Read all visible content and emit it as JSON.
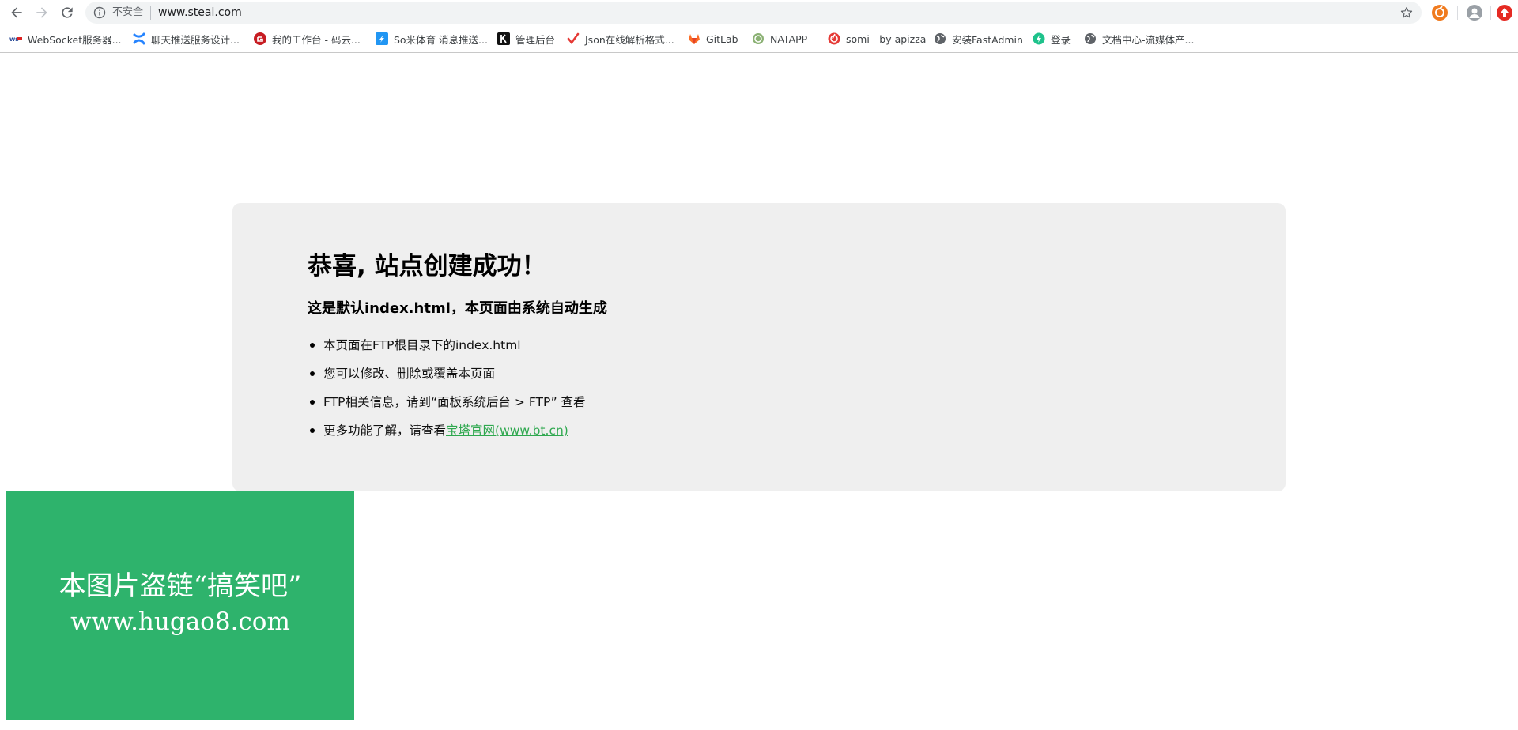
{
  "browser": {
    "security_label": "不安全",
    "url": "www.steal.com"
  },
  "bookmarks": [
    {
      "label": "WebSocket服务器...",
      "icon": "websocket-icon"
    },
    {
      "label": "聊天推送服务设计...",
      "icon": "confluence-icon"
    },
    {
      "label": "我的工作台 - 码云...",
      "icon": "gitee-icon"
    },
    {
      "label": "So米体育 消息推送...",
      "icon": "lanhu-icon"
    },
    {
      "label": "管理后台",
      "icon": "k-icon"
    },
    {
      "label": "Json在线解析格式...",
      "icon": "checkmark-icon"
    },
    {
      "label": "GitLab",
      "icon": "gitlab-icon"
    },
    {
      "label": "NATAPP -",
      "icon": "natapp-icon"
    },
    {
      "label": "somi - by apizza",
      "icon": "apizza-icon"
    },
    {
      "label": "安装FastAdmin",
      "icon": "globe-icon"
    },
    {
      "label": "登录",
      "icon": "shield-icon"
    },
    {
      "label": "文档中心-流媒体产...",
      "icon": "globe-icon"
    }
  ],
  "page": {
    "title": "恭喜, 站点创建成功！",
    "subtitle": "这是默认index.html，本页面由系统自动生成",
    "items": [
      "本页面在FTP根目录下的index.html",
      "您可以修改、删除或覆盖本页面",
      "FTP相关信息，请到“面板系统后台 > FTP” 查看"
    ],
    "more_prefix": "更多功能了解，请查看",
    "more_link": "宝塔官网(www.bt.cn)"
  },
  "watermark": {
    "line1": "本图片盗链“搞笑吧”",
    "line2": "www.hugao8.com"
  },
  "colors": {
    "watermark_bg": "#2eb36c",
    "link": "#2fa84f",
    "card_bg": "#efefef"
  }
}
